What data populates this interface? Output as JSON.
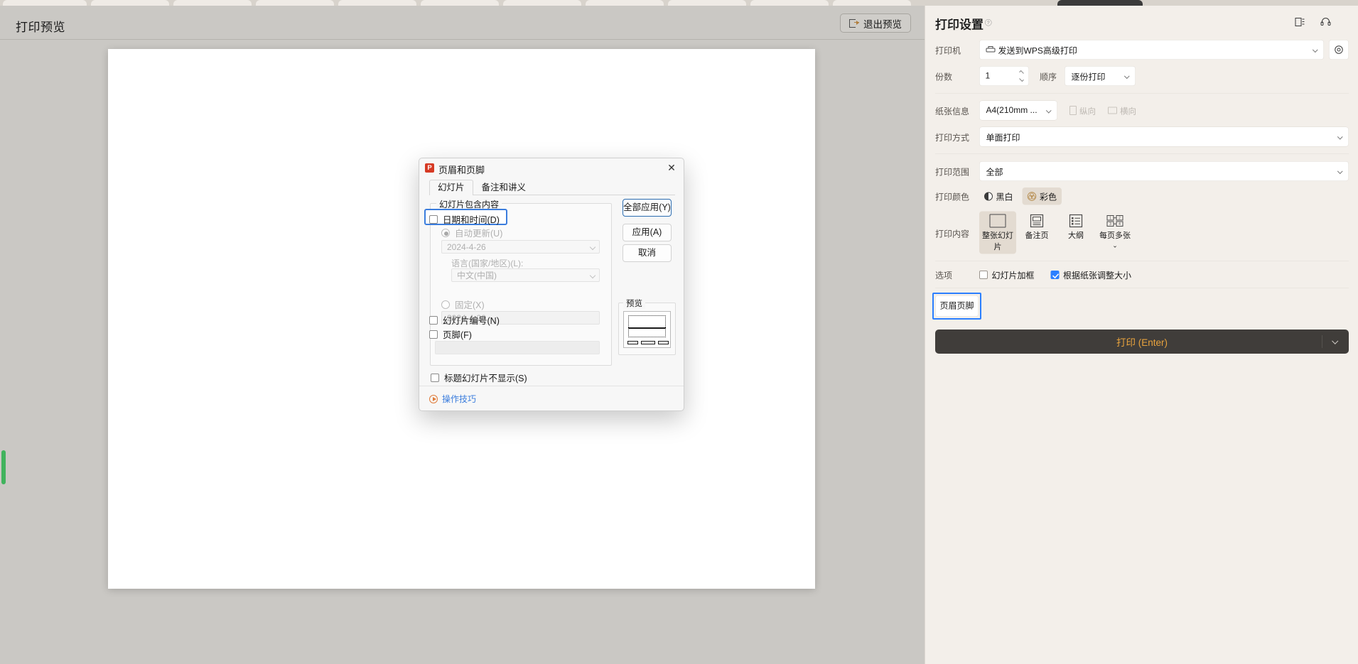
{
  "preview": {
    "title": "打印预览",
    "exit_button": "退出预览"
  },
  "dialog": {
    "title": "页眉和页脚",
    "app_icon_letter": "P",
    "tabs": [
      {
        "label": "幻灯片",
        "active": true
      },
      {
        "label": "备注和讲义",
        "active": false
      }
    ],
    "group_legend": "幻灯片包含内容",
    "date_time_checkbox": "日期和时间(D)",
    "auto_update_radio": "自动更新(U)",
    "auto_update_value": "2024-4-26",
    "language_label": "语言(国家/地区)(L):",
    "language_value": "中文(中国)",
    "fixed_radio": "固定(X)",
    "fixed_value": "2024-4-26",
    "slide_number_checkbox": "幻灯片编号(N)",
    "footer_checkbox": "页脚(F)",
    "footer_value": "",
    "title_slide_checkbox": "标题幻灯片不显示(S)",
    "tips_link": "操作技巧",
    "buttons": {
      "apply_all": "全部应用(Y)",
      "apply": "应用(A)",
      "cancel": "取消"
    },
    "preview_legend": "预览"
  },
  "settings": {
    "title": "打印设置",
    "help_glyph": "?",
    "printer_label": "打印机",
    "printer_value": "发送到WPS高级打印",
    "copies_label": "份数",
    "copies_value": "1",
    "order_label": "顺序",
    "order_value": "逐份打印",
    "paper_label": "纸张信息",
    "paper_value": "A4(210mm ...",
    "orientation_portrait": "纵向",
    "orientation_landscape": "横向",
    "duplex_label": "打印方式",
    "duplex_value": "单面打印",
    "range_label": "打印范围",
    "range_value": "全部",
    "color_label": "打印颜色",
    "color_bw": "黑白",
    "color_color": "彩色",
    "content_label": "打印内容",
    "content_options": [
      {
        "label": "整张幻灯片",
        "selected": true
      },
      {
        "label": "备注页",
        "selected": false
      },
      {
        "label": "大纲",
        "selected": false
      },
      {
        "label": "每页多张",
        "selected": false
      }
    ],
    "options_label": "选项",
    "option_frame": "幻灯片加框",
    "option_scale": "根据纸张调整大小",
    "header_footer_button": "页眉页脚",
    "print_button": "打印 (Enter)"
  },
  "colors": {
    "accent_blue": "#2b7fff",
    "print_orange": "#e8a33d",
    "selected_tan": "#e3dbd1",
    "panel_bg": "#f3efea"
  }
}
